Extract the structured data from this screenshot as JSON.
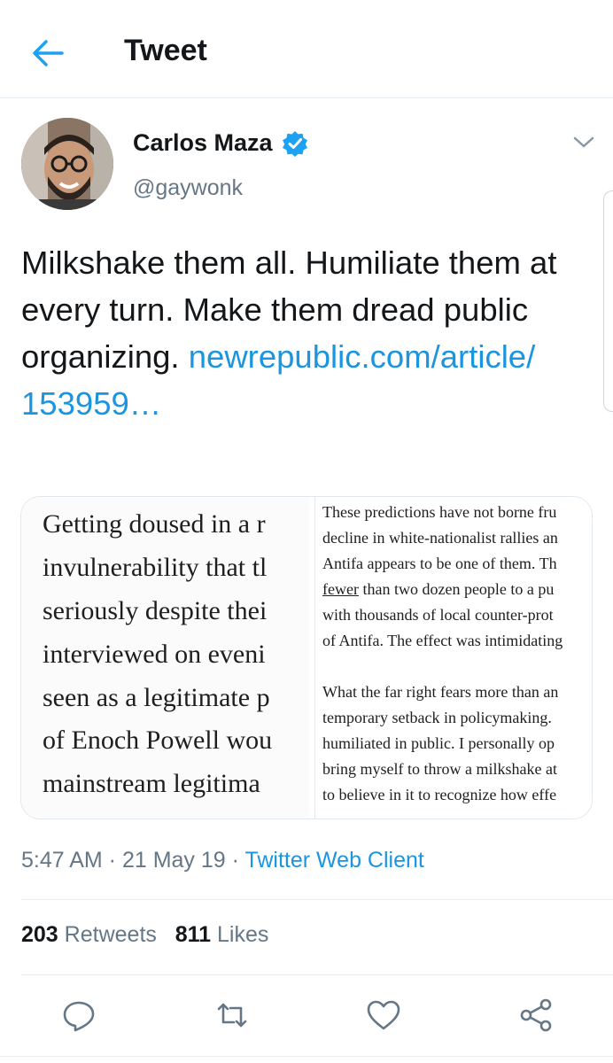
{
  "header": {
    "title": "Tweet",
    "back_icon": "arrow-left-icon",
    "accent": "#1da1f2"
  },
  "tweet": {
    "author_name": "Carlos Maza",
    "handle": "@gaywonk",
    "verified": true,
    "text": "Milkshake them all. Humiliate them at every turn. Make them dread public organizing.",
    "link_line1": "newrepublic.com/article/",
    "link_line2": "153959…",
    "link_color": "#1b95e0"
  },
  "media": {
    "left_lines": [
      "Getting doused in a r",
      "invulnerability that tl",
      "seriously despite thei",
      "interviewed on eveni",
      "seen as a legitimate p",
      "of Enoch Powell wou",
      "mainstream legitima"
    ],
    "right_para1": [
      "These predictions have not borne fru",
      "decline in white-nationalist rallies an",
      "Antifa appears to be one of them. Th",
      "fewer",
      " than two dozen people to a pu",
      "with thousands of local counter-prot",
      "of Antifa. The effect was intimidating"
    ],
    "right_para2": [
      "What the far right fears more than an",
      "temporary setback in policymaking.",
      "humiliated in public. I personally op",
      "bring myself to throw a milkshake at",
      "to believe in it to recognize how effe"
    ]
  },
  "meta": {
    "time": "5:47 AM",
    "date": "21 May 19",
    "sep": " · ",
    "source": "Twitter Web Client"
  },
  "stats": {
    "retweets_count": "203",
    "retweets_label": "Retweets",
    "likes_count": "811",
    "likes_label": "Likes"
  },
  "actions": [
    "reply-icon",
    "retweet-icon",
    "like-icon",
    "share-icon"
  ]
}
